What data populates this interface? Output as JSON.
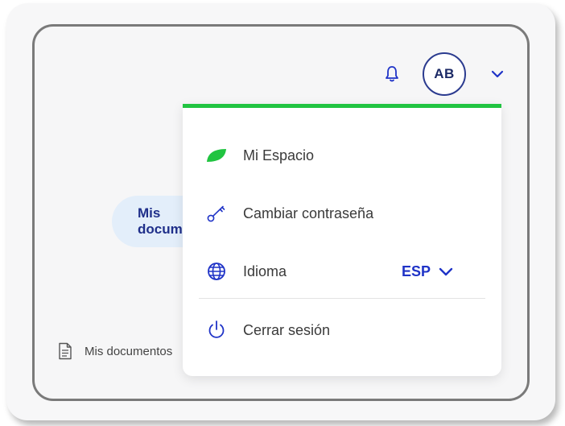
{
  "header": {
    "avatar_initials": "AB",
    "icons": {
      "notifications": "bell-icon",
      "menu_toggle": "chevron-down-icon"
    }
  },
  "background": {
    "tab_pill_label": "Mis documentos",
    "doc_link_label": "Mis documentos"
  },
  "menu": {
    "accent_color": "#21c441",
    "items": [
      {
        "label": "Mi Espacio",
        "icon": "leaf-icon"
      },
      {
        "label": "Cambiar contraseña",
        "icon": "key-icon"
      },
      {
        "label": "Idioma",
        "icon": "globe-icon",
        "value": "ESP"
      },
      {
        "label": "Cerrar sesión",
        "icon": "power-icon"
      }
    ]
  },
  "colors": {
    "brand_blue": "#1f33c7",
    "accent_green": "#21c441",
    "navy": "#1c2a66"
  }
}
